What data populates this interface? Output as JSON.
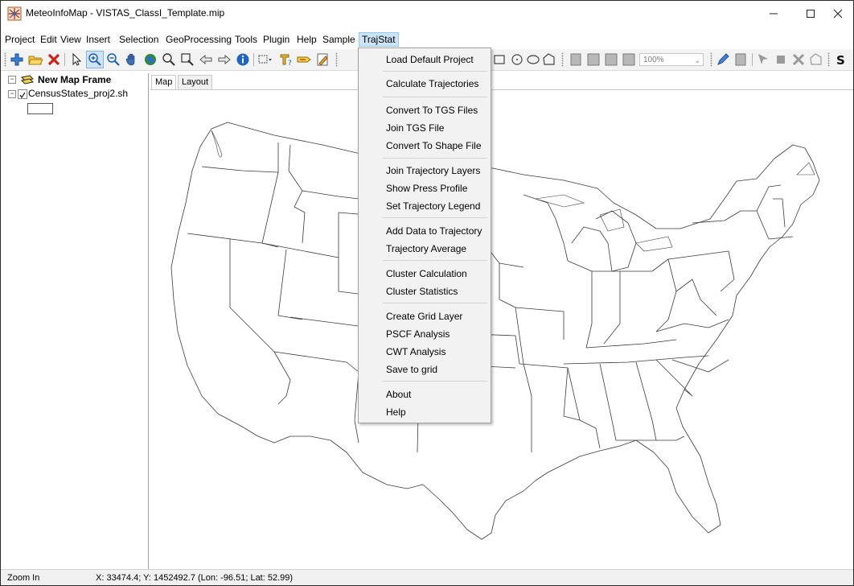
{
  "window": {
    "title": "MeteoInfoMap - VISTAS_ClassI_Template.mip",
    "minimize_icon": "minimize-icon",
    "maximize_icon": "maximize-icon",
    "close_icon": "close-icon"
  },
  "menubar": {
    "items": [
      "Project",
      "Edit",
      "View",
      "Insert",
      "Selection",
      "GeoProcessing",
      "Tools",
      "Plugin",
      "Help",
      "Sample",
      "TrajStat"
    ],
    "active": "TrajStat"
  },
  "toolbar": {
    "zoom_value": "100%",
    "icons": [
      "add-layer-icon",
      "open-project-icon",
      "remove-layer-icon",
      "select-icon",
      "zoom-in-icon",
      "zoom-out-icon",
      "pan-icon",
      "full-extent-icon",
      "zoom-to-layer-icon",
      "zoom-to-selection-icon",
      "back-icon",
      "forward-icon",
      "identify-icon",
      "select-features-icon",
      "measure-icon",
      "label-icon",
      "edit-icon",
      "rectangle-icon",
      "circle-icon",
      "ellipse-icon",
      "polygon-icon",
      "page-icon",
      "zoom-page-in-icon",
      "zoom-page-out-icon",
      "fit-page-icon",
      "pencil-icon",
      "save-edit-icon",
      "select-vertex-icon",
      "add-feature-icon",
      "delete-feature-icon",
      "split-polygon-icon",
      "script-icon"
    ]
  },
  "legend": {
    "frame_label": "New Map Frame",
    "layer_label": "CensusStates_proj2.sh"
  },
  "tabs": [
    "Map",
    "Layout"
  ],
  "status": {
    "mode": "Zoom In",
    "coords": "X: 33474.4; Y: 1452492.7 (Lon: -96.51; Lat: 52.99)"
  },
  "trajstat_menu": {
    "groups": [
      [
        "Load Default Project"
      ],
      [
        "Calculate Trajectories"
      ],
      [
        "Convert To TGS Files",
        "Join TGS File",
        "Convert To Shape File"
      ],
      [
        "Join Trajectory Layers",
        "Show Press Profile",
        "Set Trajectory Legend"
      ],
      [
        "Add Data to Trajectory",
        "Trajectory Average"
      ],
      [
        "Cluster Calculation",
        "Cluster Statistics"
      ],
      [
        "Create Grid Layer",
        "PSCF Analysis",
        "CWT Analysis",
        "Save to grid"
      ],
      [
        "About",
        "Help"
      ]
    ]
  },
  "colors": {
    "menu_active_bg": "#cce4f7",
    "map_outline": "#3a3a3a",
    "dropdown_bg": "#f2f2f2"
  }
}
